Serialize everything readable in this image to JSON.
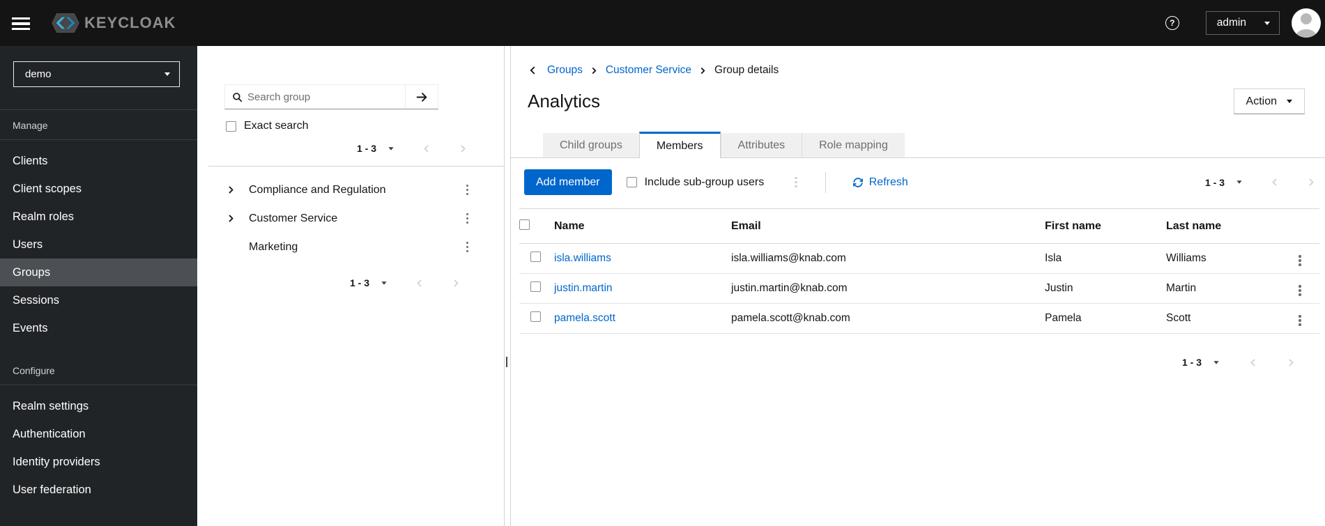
{
  "masthead": {
    "brand_text": "KEYCLOAK",
    "help_icon": "?",
    "username": "admin"
  },
  "sidebar": {
    "realm_selector": {
      "value": "demo"
    },
    "manage": {
      "label": "Manage",
      "items": [
        "Clients",
        "Client scopes",
        "Realm roles",
        "Users",
        "Groups",
        "Sessions",
        "Events"
      ],
      "selected": "Groups"
    },
    "configure": {
      "label": "Configure",
      "items": [
        "Realm settings",
        "Authentication",
        "Identity providers",
        "User federation"
      ]
    }
  },
  "tree_panel": {
    "search": {
      "placeholder": "Search group"
    },
    "exact_search_label": "Exact search",
    "pagination_top": {
      "range": "1 - 3"
    },
    "groups": [
      {
        "name": "Compliance and Regulation",
        "expandable": true
      },
      {
        "name": "Customer Service",
        "expandable": true
      },
      {
        "name": "Marketing",
        "expandable": false
      }
    ],
    "pagination_bottom": {
      "range": "1 - 3"
    }
  },
  "main": {
    "breadcrumb": {
      "items": [
        "Groups",
        "Customer Service"
      ],
      "current": "Group details"
    },
    "title": "Analytics",
    "action_button": "Action",
    "tabs": [
      "Child groups",
      "Members",
      "Attributes",
      "Role mapping"
    ],
    "active_tab": "Members",
    "toolbar": {
      "add_member_button": "Add member",
      "include_subgroup_label": "Include sub-group users",
      "refresh_label": "Refresh",
      "pagination": {
        "range": "1 - 3"
      }
    },
    "table": {
      "headers": {
        "name": "Name",
        "email": "Email",
        "first_name": "First name",
        "last_name": "Last name"
      },
      "rows": [
        {
          "name": "isla.williams",
          "email": "isla.williams@knab.com",
          "first_name": "Isla",
          "last_name": "Williams"
        },
        {
          "name": "justin.martin",
          "email": "justin.martin@knab.com",
          "first_name": "Justin",
          "last_name": "Martin"
        },
        {
          "name": "pamela.scott",
          "email": "pamela.scott@knab.com",
          "first_name": "Pamela",
          "last_name": "Scott"
        }
      ]
    },
    "pagination_bottom": {
      "range": "1 - 3"
    }
  },
  "colors": {
    "accent": "#0066cc",
    "link": "#0066cc",
    "masthead_bg": "#141414",
    "sidebar_bg": "#212427",
    "sidebar_selected_bg": "#4c5055",
    "tab_inactive_bg": "#f0f0f0"
  }
}
